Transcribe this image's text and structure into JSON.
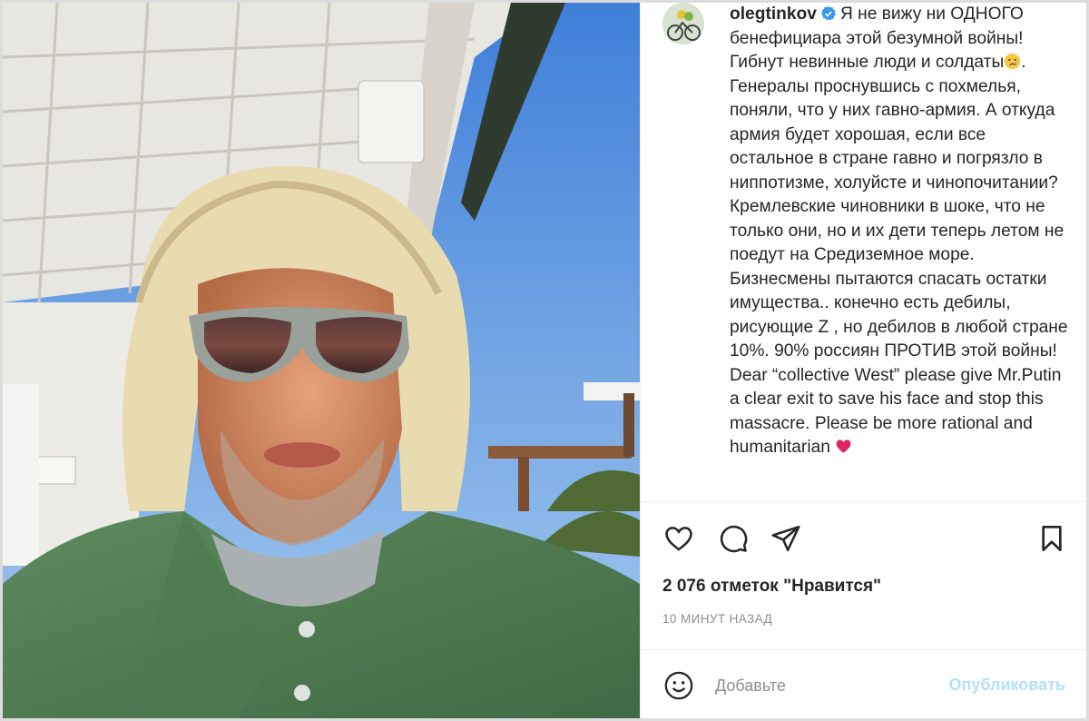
{
  "post": {
    "username": "olegtinkov",
    "caption": "Я не вижу ни ОДНОГО бенефициара этой безумной войны! Гибнут невинные люди и солдаты",
    "caption_rest": ". Генералы проснувшись с похмелья, поняли, что у них гавно-армия. А откуда армия будет хорошая, если все остальное в стране гавно и погрязло в ниппотизме, холуйсте и чинопочитании? Кремлевские чиновники в шоке, что не только они, но и их дети теперь летом не поедут на Средиземное море. Бизнесмены пытаются спасать остатки имущества.. конечно есть дебилы, рисующие Z , но дебилов в любой стране 10%. 90% россиян ПРОТИВ этой войны! Dear “collective West” please give Mr.Putin a clear exit to save his face and stop this massacre. Please be more rational and humanitarian ",
    "likes": "2 076 отметок \"Нравится\"",
    "time": "10 МИНУТ НАЗАД"
  },
  "comment": {
    "placeholder": "Добавьте",
    "publish_label": "Опубликовать"
  },
  "icons": {
    "like": "heart-icon",
    "comment": "comment-icon",
    "share": "paper-plane-icon",
    "save": "bookmark-icon",
    "emoji": "smiley-icon",
    "verified": "verified-badge-icon"
  },
  "colors": {
    "verified": "#3897f0",
    "publish_disabled": "#b2dffc",
    "text": "#262626",
    "muted": "#8e8e8e",
    "heart_emoji": "#e0245e"
  }
}
